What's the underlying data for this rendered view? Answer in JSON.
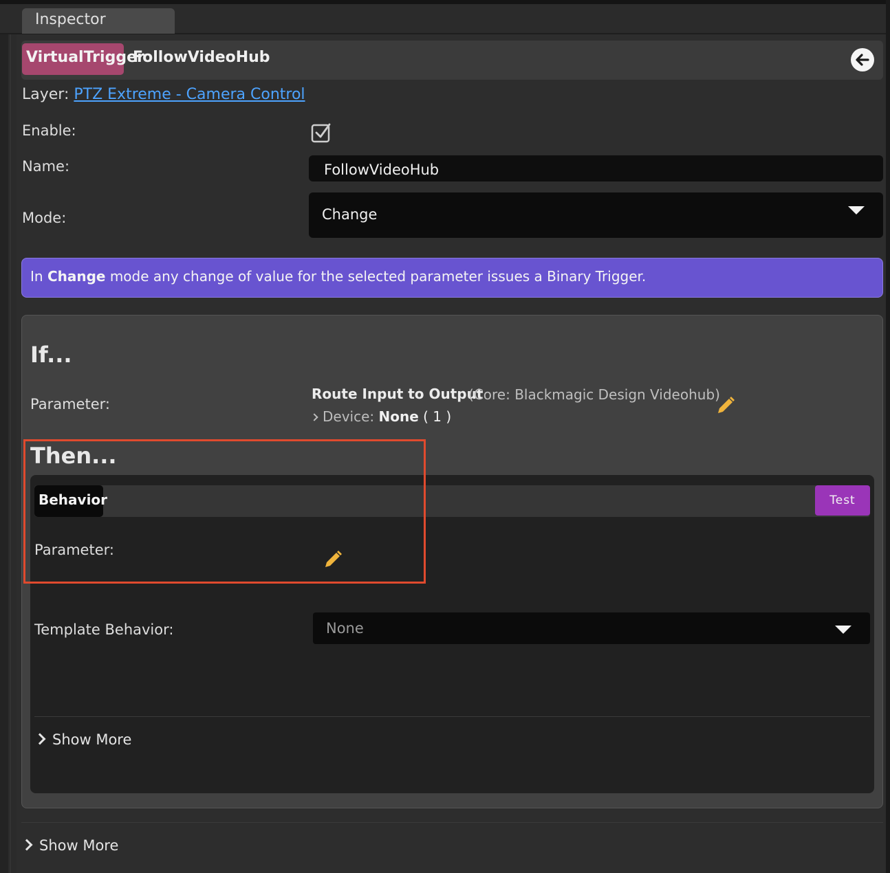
{
  "tab": {
    "label": "Inspector"
  },
  "header": {
    "type_badge": "VirtualTrigger",
    "name": "FollowVideoHub",
    "badge_color": "#a6476e"
  },
  "layer": {
    "prefix": "Layer:",
    "link_text": "PTZ Extreme - Camera Control"
  },
  "fields": {
    "enable_label": "Enable:",
    "enable_checked": true,
    "name_label": "Name:",
    "name_value": "FollowVideoHub",
    "mode_label": "Mode:",
    "mode_value": "Change"
  },
  "info": {
    "pre": "In ",
    "bold": "Change",
    "post": " mode any change of value for the selected parameter issues a Binary Trigger.",
    "color": "#6854d0"
  },
  "if_section": {
    "title": "If...",
    "parameter_label": "Parameter:",
    "parameter_name": "Route Input to Output",
    "parameter_core": "(Core: Blackmagic Design Videohub)",
    "device_label": "Device:",
    "device_value": "None",
    "device_count": "( 1 )"
  },
  "then_section": {
    "title": "Then...",
    "behavior_tag": "Behavior",
    "test_label": "Test",
    "test_color": "#9a35b8",
    "parameter_label": "Parameter:",
    "template_label": "Template Behavior:",
    "template_value": "None",
    "show_more": "Show More"
  },
  "footer": {
    "show_more": "Show More"
  },
  "icons": {
    "back": "arrow-left-circle-icon",
    "checkbox": "checkbox-checked-icon",
    "pencil": "pencil-icon",
    "pencil_color": "#f0b43c"
  }
}
